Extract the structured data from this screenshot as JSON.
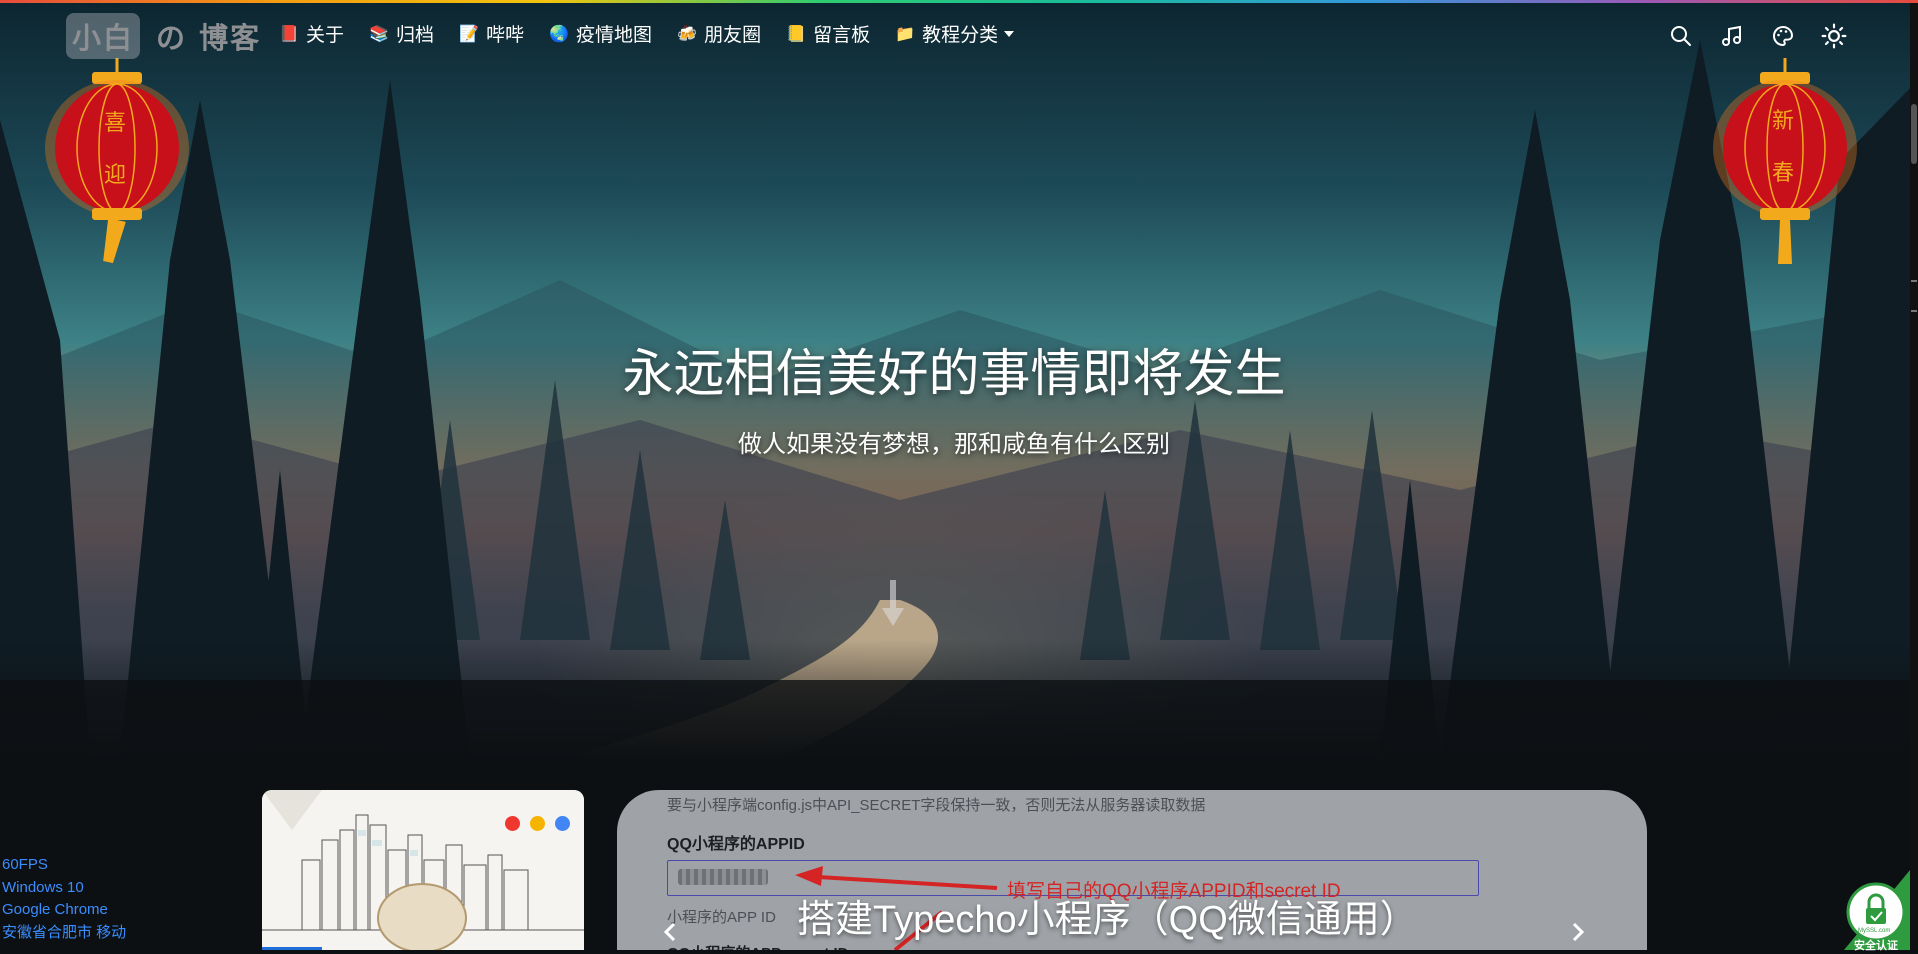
{
  "site": {
    "logo_box": "小白",
    "logo_rest": "の 博客"
  },
  "nav": {
    "items": [
      {
        "label": "关于",
        "icon": "notebook-icon",
        "emoji": "📕",
        "dropdown": false
      },
      {
        "label": "归档",
        "icon": "books-icon",
        "emoji": "📚",
        "dropdown": false
      },
      {
        "label": "哔哔",
        "icon": "memo-icon",
        "emoji": "📝",
        "dropdown": false
      },
      {
        "label": "疫情地图",
        "icon": "globe-icon",
        "emoji": "🌏",
        "dropdown": false
      },
      {
        "label": "朋友圈",
        "icon": "beer-icon",
        "emoji": "🍻",
        "dropdown": false
      },
      {
        "label": "留言板",
        "icon": "ledger-icon",
        "emoji": "📒",
        "dropdown": false
      },
      {
        "label": "教程分类",
        "icon": "folder-icon",
        "emoji": "📁",
        "dropdown": true
      }
    ],
    "right_icons": [
      "search-icon",
      "music-icon",
      "palette-icon",
      "theme-toggle-icon"
    ]
  },
  "lanterns": {
    "left": [
      "喜",
      "迎"
    ],
    "right": [
      "新",
      "春"
    ]
  },
  "hero": {
    "title": "永远相信美好的事情即将发生",
    "subtitle": "做人如果没有梦想，那和咸鱼有什么区别"
  },
  "post_card": {
    "note": "要与小程序端config.js中API_SECRET字段保持一致，否则无法从服务器读取数据",
    "label": "QQ小程序的APPID",
    "annotation": "填写自己的QQ小程序APPID和secret ID",
    "hint": "小程序的APP ID",
    "hint2": "QQ小程序的APP secret ID",
    "title": "搭建Typecho小程序（QQ微信通用）"
  },
  "stats": {
    "fps": "60FPS",
    "os": "Windows 10",
    "browser": "Google Chrome",
    "location": "安徽省合肥市 移动"
  },
  "badge": {
    "text": "安全认证",
    "brand": "MySSL.com"
  },
  "colors": {
    "accent": "#3a8dff",
    "annotation": "#d42424",
    "lantern_red": "#c8101a",
    "lantern_gold": "#f2a91c"
  }
}
